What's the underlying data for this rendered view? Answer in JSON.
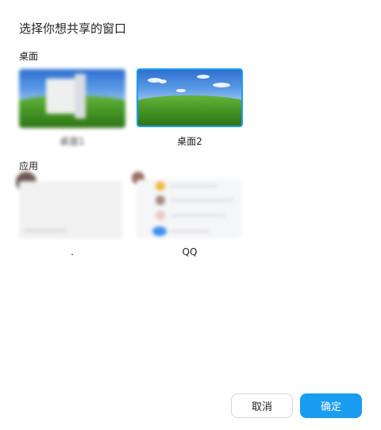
{
  "dialog": {
    "title": "选择你想共享的窗口"
  },
  "sections": {
    "desktop_label": "桌面",
    "apps_label": "应用"
  },
  "desktops": [
    {
      "label": "桌面1",
      "selected": false,
      "blurred": true
    },
    {
      "label": "桌面2",
      "selected": true,
      "blurred": false
    }
  ],
  "apps": [
    {
      "label": ".",
      "blurred": true
    },
    {
      "label": "QQ",
      "blurred": true
    }
  ],
  "buttons": {
    "cancel": "取消",
    "ok": "确定"
  },
  "colors": {
    "accent": "#1a9cf0",
    "selection_border": "#1a9cf0"
  }
}
